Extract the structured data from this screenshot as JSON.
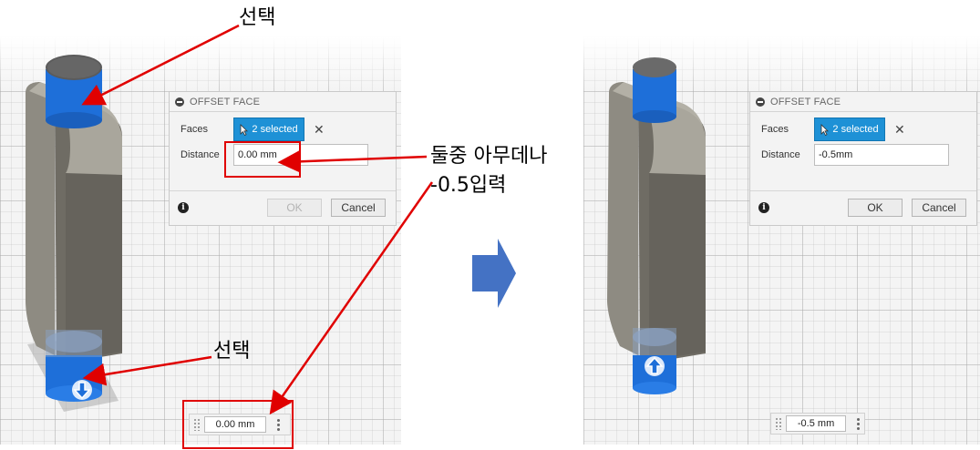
{
  "left": {
    "dialog": {
      "title": "OFFSET FACE",
      "faces_label": "Faces",
      "faces_value": "2 selected",
      "distance_label": "Distance",
      "distance_value": "0.00 mm",
      "ok_label": "OK",
      "cancel_label": "Cancel",
      "ok_enabled": false
    },
    "mini_input_value": "0.00 mm"
  },
  "right": {
    "dialog": {
      "title": "OFFSET FACE",
      "faces_label": "Faces",
      "faces_value": "2 selected",
      "distance_label": "Distance",
      "distance_value": "-0.5mm",
      "ok_label": "OK",
      "cancel_label": "Cancel",
      "ok_enabled": true
    },
    "mini_input_value": "-0.5 mm"
  },
  "annotations": {
    "select_top": "선택",
    "select_bottom": "선택",
    "instruction_line1": "둘중 아무데나",
    "instruction_line2": "-0.5입력"
  },
  "colors": {
    "selection_blue": "#1e6fd9",
    "accent_button": "#1e91d6",
    "annotation_red": "#e00000",
    "arrow_blue": "#4472c4",
    "body_gray": "#5f5c55"
  },
  "icons": [
    "minimize-icon",
    "cursor-icon",
    "close-icon",
    "info-icon",
    "grip-icon",
    "more-menu-icon",
    "offset-arrow-icon",
    "next-step-arrow-icon"
  ]
}
